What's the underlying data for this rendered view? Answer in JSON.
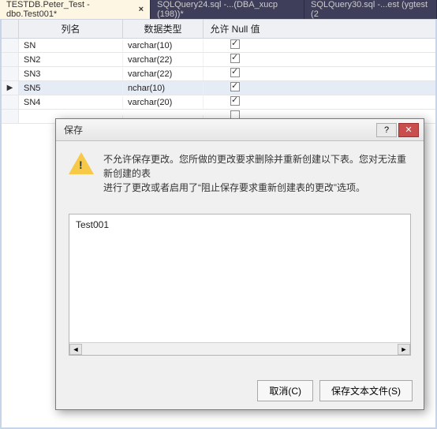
{
  "tabs": [
    {
      "label": "TESTDB.Peter_Test - dbo.Test001*",
      "active": true,
      "closable": true
    },
    {
      "label": "SQLQuery24.sql -...(DBA_xucp (198))*",
      "active": false,
      "closable": false
    },
    {
      "label": "SQLQuery30.sql -...est (ygtest (2",
      "active": false,
      "closable": false
    }
  ],
  "grid": {
    "headers": {
      "name": "列名",
      "type": "数据类型",
      "nulls": "允许 Null 值"
    },
    "rows": [
      {
        "name": "SN",
        "type": "varchar(10)",
        "null": true,
        "current": false
      },
      {
        "name": "SN2",
        "type": "varchar(22)",
        "null": true,
        "current": false
      },
      {
        "name": "SN3",
        "type": "varchar(22)",
        "null": true,
        "current": false
      },
      {
        "name": "SN5",
        "type": "nchar(10)",
        "null": true,
        "current": true
      },
      {
        "name": "SN4",
        "type": "varchar(20)",
        "null": true,
        "current": false
      },
      {
        "name": "",
        "type": "",
        "null": false,
        "current": false
      }
    ]
  },
  "dialog": {
    "title": "保存",
    "message_line1": "不允许保存更改。您所做的更改要求删除并重新创建以下表。您对无法重新创建的表",
    "message_line2": "进行了更改或者启用了“阻止保存要求重新创建表的更改”选项。",
    "list_items": [
      "Test001"
    ],
    "buttons": {
      "cancel": "取消(C)",
      "savetext": "保存文本文件(S)"
    }
  }
}
